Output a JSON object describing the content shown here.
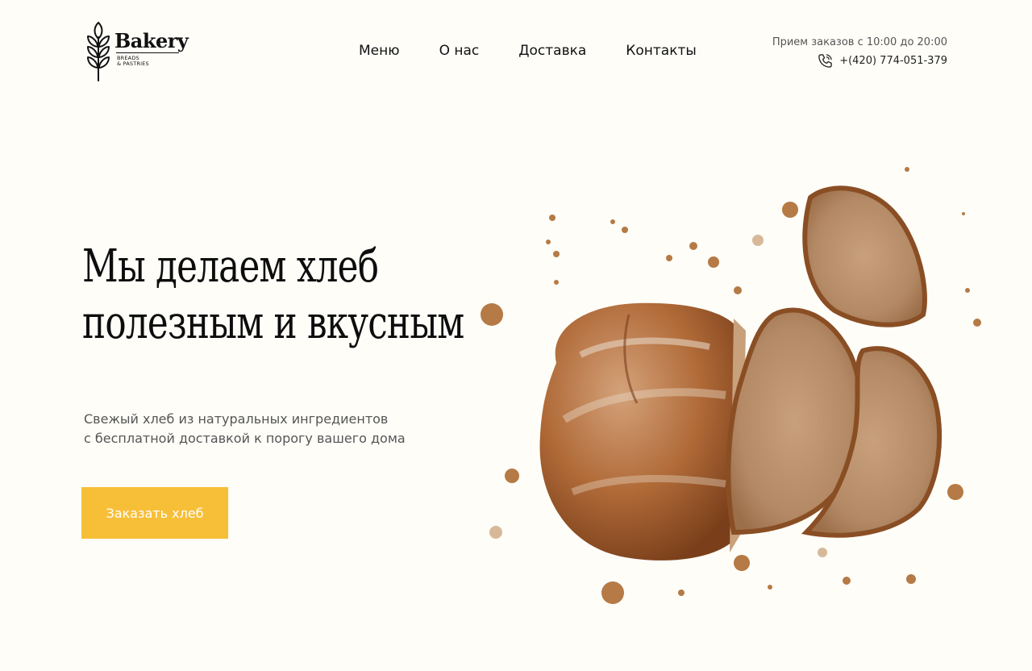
{
  "brand": {
    "name": "Bakery",
    "tagline_line1": "BREADS",
    "tagline_line2": "& PASTRIES"
  },
  "nav": {
    "items": [
      "Меню",
      "О нас",
      "Доставка",
      "Контакты"
    ]
  },
  "contact": {
    "hours": "Прием заказов с 10:00 до 20:00",
    "phone": "+(420) 774-051-379",
    "phone_icon": "phone-icon"
  },
  "hero": {
    "title_line1": "Мы делаем хлеб",
    "title_line2": "полезным и вкусным",
    "subtitle_line1": "Свежый хлеб из натуральных ингредиентов",
    "subtitle_line2": "с бесплатной доставкой к порогу вашего дома",
    "cta_label": "Заказать хлеб"
  },
  "colors": {
    "background": "#fefdf8",
    "accent": "#f7bf38",
    "text": "#111111",
    "muted": "#555555"
  },
  "image": {
    "icon": "bread-loaf-and-slices-photo"
  }
}
